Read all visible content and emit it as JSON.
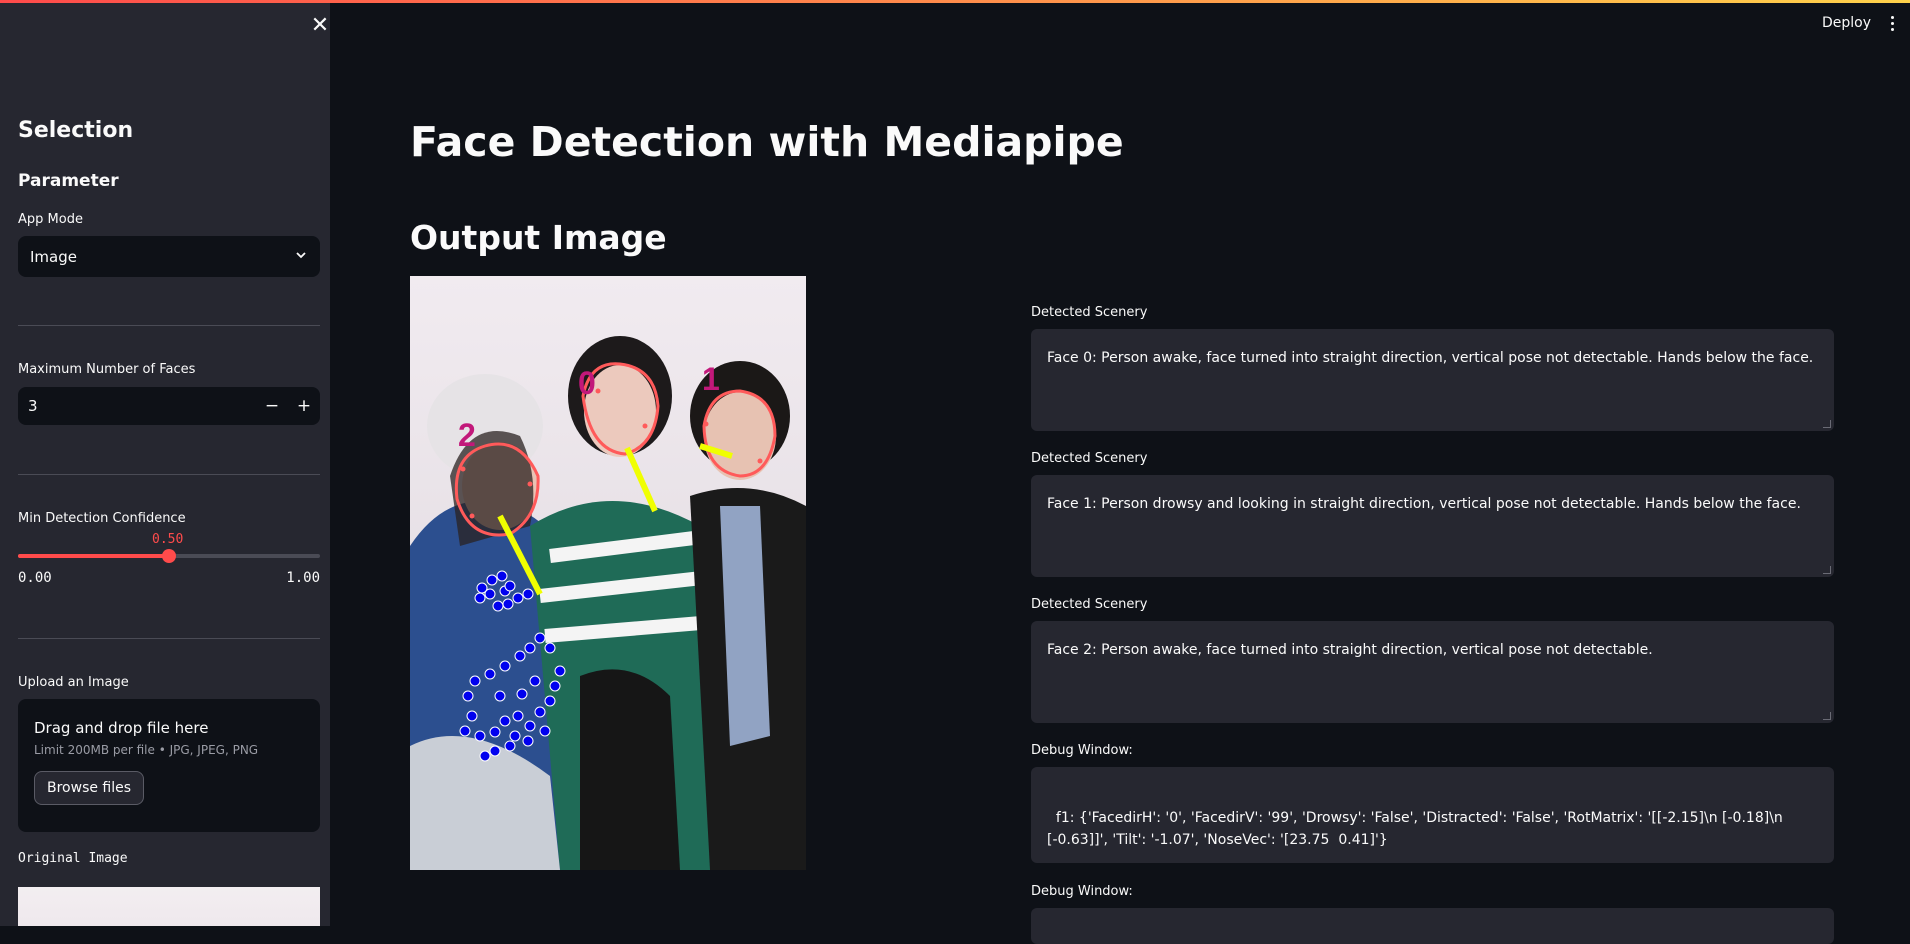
{
  "sidebar": {
    "close_icon": "close-icon",
    "title": "Selection",
    "subtitle": "Parameter",
    "app_mode": {
      "label": "App Mode",
      "value": "Image"
    },
    "max_faces": {
      "label": "Maximum Number of Faces",
      "value": "3",
      "minus": "−",
      "plus": "+"
    },
    "confidence": {
      "label": "Min Detection Confidence",
      "value": "0.50",
      "min": "0.00",
      "max": "1.00",
      "fraction": 0.5
    },
    "upload": {
      "label": "Upload an Image",
      "title": "Drag and drop file here",
      "limit": "Limit 200MB per file • JPG, JPEG, PNG",
      "button": "Browse files"
    },
    "original_caption": "Original Image"
  },
  "header": {
    "deploy": "Deploy",
    "menu_icon": "more-vert-icon"
  },
  "main": {
    "title": "Face Detection with Mediapipe",
    "output_heading": "Output Image",
    "image_labels": [
      "0",
      "1",
      "2"
    ],
    "fields": [
      {
        "label": "Detected Scenery",
        "value": "Face 0: Person awake, face turned into straight direction, vertical pose not detectable. Hands below the face."
      },
      {
        "label": "Detected Scenery",
        "value": "Face 1: Person drowsy and looking in straight direction, vertical pose not detectable. Hands below the face."
      },
      {
        "label": "Detected Scenery",
        "value": "Face 2: Person awake, face turned into straight direction, vertical pose not detectable."
      },
      {
        "label": "Debug Window:",
        "value": "f1: {'FacedirH': '0', 'FacedirV': '99', 'Drowsy': 'False', 'Distracted': 'False', 'RotMatrix': '[[-2.15]\\n [-0.18]\\n [-0.63]]', 'Tilt': '-1.07', 'NoseVec': '[23.75  0.41]'}"
      },
      {
        "label": "Debug Window:",
        "value": ""
      }
    ]
  },
  "colors": {
    "accent": "#ff4b4b",
    "landmark_blue": "#0000ee",
    "mesh_red": "#ff5a5a",
    "nose_yellow": "#f0ff00",
    "label_magenta": "#c2187a"
  }
}
